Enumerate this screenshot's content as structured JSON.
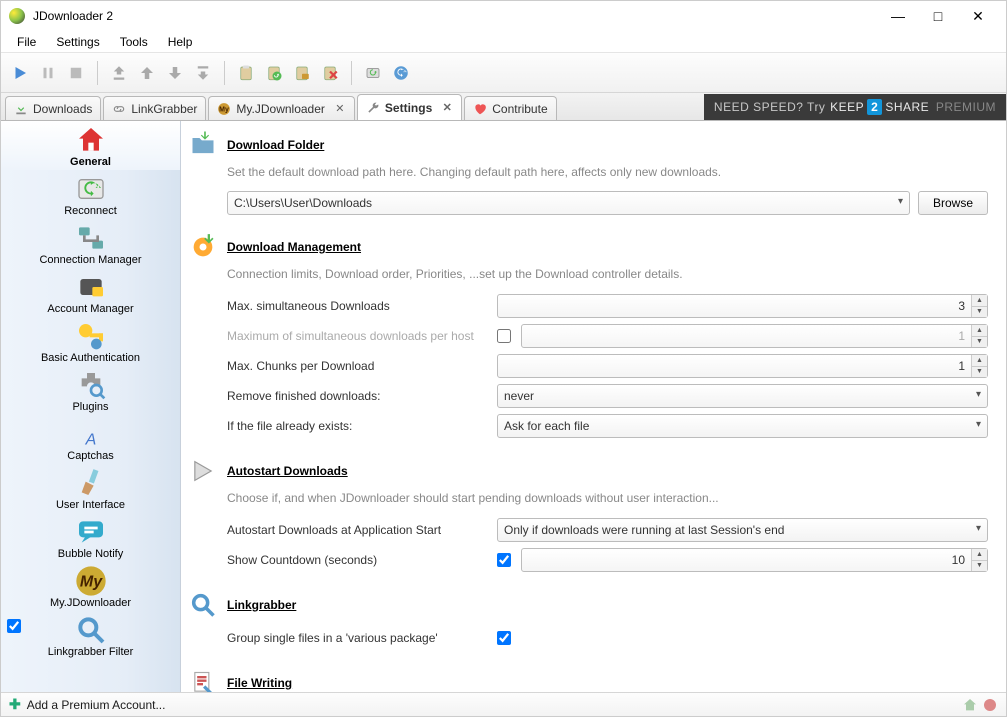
{
  "window": {
    "title": "JDownloader 2"
  },
  "menu": [
    "File",
    "Settings",
    "Tools",
    "Help"
  ],
  "tabs": [
    {
      "label": "Downloads",
      "closable": false
    },
    {
      "label": "LinkGrabber",
      "closable": false
    },
    {
      "label": "My.JDownloader",
      "closable": true
    },
    {
      "label": "Settings",
      "closable": true,
      "active": true
    },
    {
      "label": "Contribute",
      "closable": false
    }
  ],
  "promo": {
    "pre": "NEED SPEED? Try ",
    "keep": "KEEP",
    "two": "2",
    "share": "SHARE",
    "prem": "PREMIUM"
  },
  "sidebar": [
    {
      "label": "General",
      "selected": true
    },
    {
      "label": "Reconnect"
    },
    {
      "label": "Connection Manager"
    },
    {
      "label": "Account Manager"
    },
    {
      "label": "Basic Authentication"
    },
    {
      "label": "Plugins"
    },
    {
      "label": "Captchas"
    },
    {
      "label": "User Interface"
    },
    {
      "label": "Bubble Notify"
    },
    {
      "label": "My.JDownloader"
    },
    {
      "label": "Linkgrabber Filter"
    }
  ],
  "content": {
    "download_folder": {
      "title": "Download Folder",
      "desc": "Set the default download path here. Changing default path here, affects only new downloads.",
      "path": "C:\\Users\\User\\Downloads",
      "browse": "Browse"
    },
    "download_mgmt": {
      "title": "Download Management",
      "desc": "Connection limits, Download order, Priorities, ...set up the Download controller details.",
      "max_sim_label": "Max. simultaneous Downloads",
      "max_sim_value": "3",
      "max_host_label": "Maximum of simultaneous downloads per host",
      "max_host_value": "1",
      "max_chunks_label": "Max. Chunks per Download",
      "max_chunks_value": "1",
      "remove_label": "Remove finished downloads:",
      "remove_value": "never",
      "exists_label": "If the file already exists:",
      "exists_value": "Ask for each file"
    },
    "autostart": {
      "title": "Autostart Downloads",
      "desc": "Choose if, and when JDownloader should start pending downloads without user interaction...",
      "at_start_label": "Autostart Downloads at Application Start",
      "at_start_value": "Only if downloads were running at last Session's end",
      "countdown_label": "Show Countdown (seconds)",
      "countdown_value": "10"
    },
    "linkgrabber": {
      "title": "Linkgrabber",
      "group_label": "Group single files in a 'various package'"
    },
    "filewriting": {
      "title": "File Writing"
    }
  },
  "statusbar": {
    "add_premium": "Add a Premium Account..."
  }
}
